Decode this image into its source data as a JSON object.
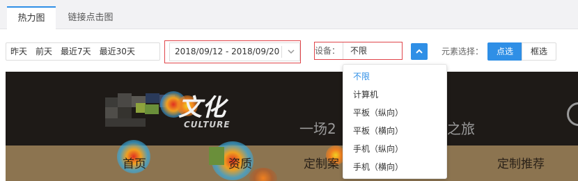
{
  "tabs": [
    {
      "label": "热力图",
      "active": true
    },
    {
      "label": "链接点击图",
      "active": false
    }
  ],
  "date_shortcuts": [
    "昨天",
    "前天",
    "最近7天",
    "最近30天"
  ],
  "date_range": {
    "value": "2018/09/12 - 2018/09/20"
  },
  "device": {
    "label": "设备：",
    "value": "不限",
    "options": [
      "不限",
      "计算机",
      "平板（纵向）",
      "平板（横向）",
      "手机（纵向）",
      "手机（横向）"
    ],
    "selected_index": 0
  },
  "element_select": {
    "label": "元素选择：",
    "options": [
      "点选",
      "框选"
    ],
    "active": "点选"
  },
  "preview": {
    "logo_text": "文化",
    "logo_sub": "CULTURE",
    "tagline_left": "一场2",
    "tagline_right": "之旅",
    "nav": [
      "首页",
      "资质",
      "定制案",
      "定制推荐"
    ]
  },
  "colors": {
    "accent": "#2f8fe6",
    "highlight_border": "#e0454a",
    "preview_bg": "#1e1a17",
    "nav_band": "#8c7450"
  }
}
